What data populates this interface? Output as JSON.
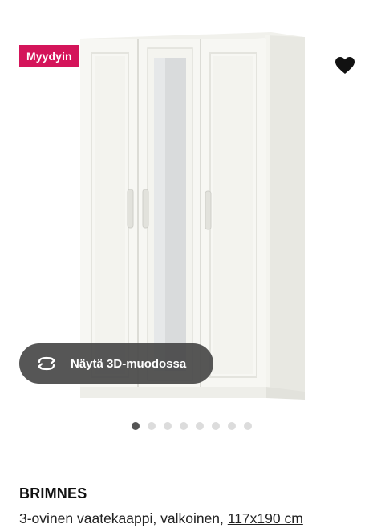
{
  "badge": {
    "label": "Myydyin",
    "color": "#d4145a"
  },
  "favorite": {
    "icon": "heart-icon"
  },
  "view3d": {
    "label": "Näytä 3D-muodossa",
    "icon": "rotate-3d-icon"
  },
  "gallery": {
    "image_count": 8,
    "active_index": 0
  },
  "product": {
    "name": "BRIMNES",
    "description": "3-ovinen vaatekaappi, valkoinen, ",
    "size_link": "117x190 cm"
  }
}
